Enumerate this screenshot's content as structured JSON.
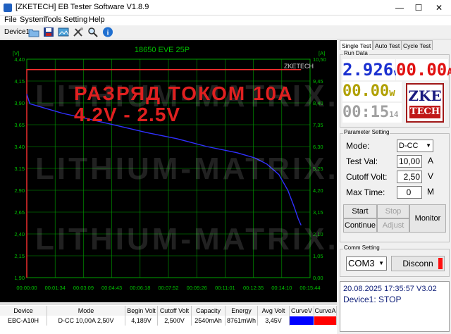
{
  "window": {
    "title": "[ZKETECH] EB Tester Software V1.8.9",
    "minimize": "—",
    "maximize": "☐",
    "close": "✕"
  },
  "menu": [
    "File",
    "System",
    "Tools",
    "Setting",
    "Help"
  ],
  "toolbar": {
    "device_label": "Device1",
    "icons": [
      "open-folder-icon",
      "save-icon",
      "chart-image-icon",
      "tools-icon",
      "search-icon",
      "info-icon"
    ]
  },
  "chart": {
    "title": "18650 EVE 25P",
    "left_unit": "[V]",
    "right_unit": "[A]",
    "corner_label": "ZKETECH",
    "overlay_line1": "РАЗРЯД ТОКОМ 10А",
    "overlay_line2": "4.2V - 2.5V",
    "watermark": "LITHIUM-MATRIX.",
    "colors": {
      "voltage": "#3030ff",
      "current": "#ff3030",
      "grid": "#00a000",
      "axis_text": "#00c000"
    }
  },
  "chart_data": {
    "type": "line",
    "title": "18650 EVE 25P",
    "ylabel": "[V]",
    "y2label": "[A]",
    "ylim": [
      1.9,
      4.4
    ],
    "y2lim": [
      0,
      10.5
    ],
    "yticks": [
      "4,40",
      "4,15",
      "3,90",
      "3,65",
      "3,40",
      "3,15",
      "2,90",
      "2,65",
      "2,40",
      "2,15",
      "1,90"
    ],
    "y2ticks": [
      "10,50",
      "9,45",
      "8,40",
      "7,35",
      "6,30",
      "5,25",
      "4,20",
      "3,15",
      "2,10",
      "1,05",
      "0,00"
    ],
    "xticks": [
      "00:00:00",
      "00:01:34",
      "00:03:09",
      "00:04:43",
      "00:06:18",
      "00:07:52",
      "00:09:26",
      "00:11:01",
      "00:12:35",
      "00:14:10",
      "00:15:44"
    ],
    "x_seconds": [
      0,
      10,
      30,
      60,
      120,
      200,
      300,
      400,
      500,
      600,
      700,
      760,
      800,
      840,
      870,
      890,
      905,
      914
    ],
    "series": [
      {
        "name": "CurveV",
        "axis": "left",
        "values": [
          4.0,
          3.89,
          3.87,
          3.84,
          3.78,
          3.72,
          3.64,
          3.56,
          3.49,
          3.4,
          3.33,
          3.27,
          3.2,
          3.08,
          2.9,
          2.72,
          2.57,
          2.5
        ]
      },
      {
        "name": "CurveA",
        "axis": "right",
        "values": [
          10.0,
          10.0,
          10.0,
          10.0,
          10.0,
          10.0,
          10.0,
          10.0,
          10.0,
          10.0,
          10.0,
          10.0,
          10.0,
          10.0,
          10.0,
          10.0,
          10.0,
          10.0
        ]
      }
    ],
    "grid": true
  },
  "table": {
    "headers": [
      "Device",
      "Mode",
      "Begin Volt",
      "Cutoff Volt",
      "Capacity",
      "Energy",
      "Avg Volt",
      "CurveV",
      "CurveA"
    ],
    "row": [
      "EBC-A10H",
      "D-CC  10,00A  2,50V",
      "4,189V",
      "2,500V",
      "2540mAh",
      "8761mWh",
      "3,45V",
      "",
      ""
    ],
    "curve_colors": [
      "#0000ff",
      "#ff0000"
    ]
  },
  "tabs": [
    "Single Test",
    "Auto Test",
    "Cycle Test"
  ],
  "run_data": {
    "label": "Run Data",
    "voltage": "2.926",
    "voltage_unit": "v",
    "current": "00.00",
    "current_unit": "A",
    "power": "00.00",
    "power_unit": "w",
    "time_hm": "00:15",
    "time_s": "14",
    "logo_top": "ZKE",
    "logo_bottom": "TECH"
  },
  "params": {
    "label": "Parameter Setting",
    "mode_label": "Mode:",
    "mode_value": "D-CC",
    "test_label": "Test Val:",
    "test_value": "10,00",
    "test_unit": "A",
    "cutoff_label": "Cutoff Volt:",
    "cutoff_value": "2,50",
    "cutoff_unit": "V",
    "maxtime_label": "Max Time:",
    "maxtime_value": "0",
    "maxtime_unit": "M",
    "start": "Start",
    "stop": "Stop",
    "continue": "Continue",
    "adjust": "Adjust",
    "monitor": "Monitor"
  },
  "comm": {
    "label": "Comm Setting",
    "port": "COM3",
    "disconnect": "Disconn"
  },
  "status": {
    "datetime": "20.08.2025 17:35:57  V3.02",
    "device": "Device1: STOP"
  }
}
